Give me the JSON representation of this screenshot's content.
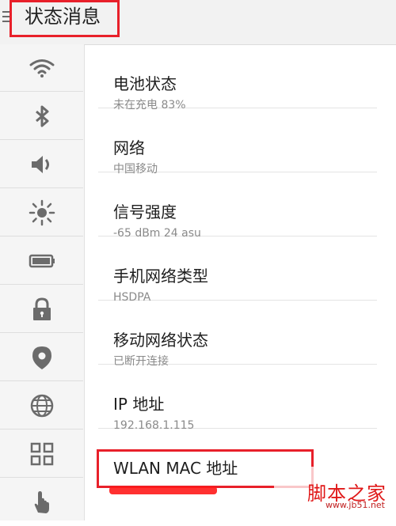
{
  "header": {
    "title": "状态消息"
  },
  "sidebar": {
    "items": [
      {
        "icon": "wifi-icon"
      },
      {
        "icon": "bluetooth-icon"
      },
      {
        "icon": "volume-icon"
      },
      {
        "icon": "brightness-icon"
      },
      {
        "icon": "battery-icon"
      },
      {
        "icon": "lock-icon"
      },
      {
        "icon": "location-icon"
      },
      {
        "icon": "globe-icon"
      },
      {
        "icon": "apps-grid-icon"
      },
      {
        "icon": "touch-hand-icon"
      }
    ]
  },
  "status": {
    "items": [
      {
        "title": "电池状态",
        "value": "未在充电  83%"
      },
      {
        "title": "网络",
        "value": "中国移动"
      },
      {
        "title": "信号强度",
        "value": "-65 dBm  24 asu"
      },
      {
        "title": "手机网络类型",
        "value": "HSDPA"
      },
      {
        "title": "移动网络状态",
        "value": "已断开连接"
      },
      {
        "title": "IP 地址",
        "value": "192.168.1.115"
      },
      {
        "title": "WLAN MAC 地址",
        "value": ""
      }
    ]
  },
  "watermark": {
    "main": "脚本之家",
    "url": "www.jb51.net"
  },
  "colors": {
    "highlight": "#e8202a",
    "icon": "#6b6b6b"
  }
}
